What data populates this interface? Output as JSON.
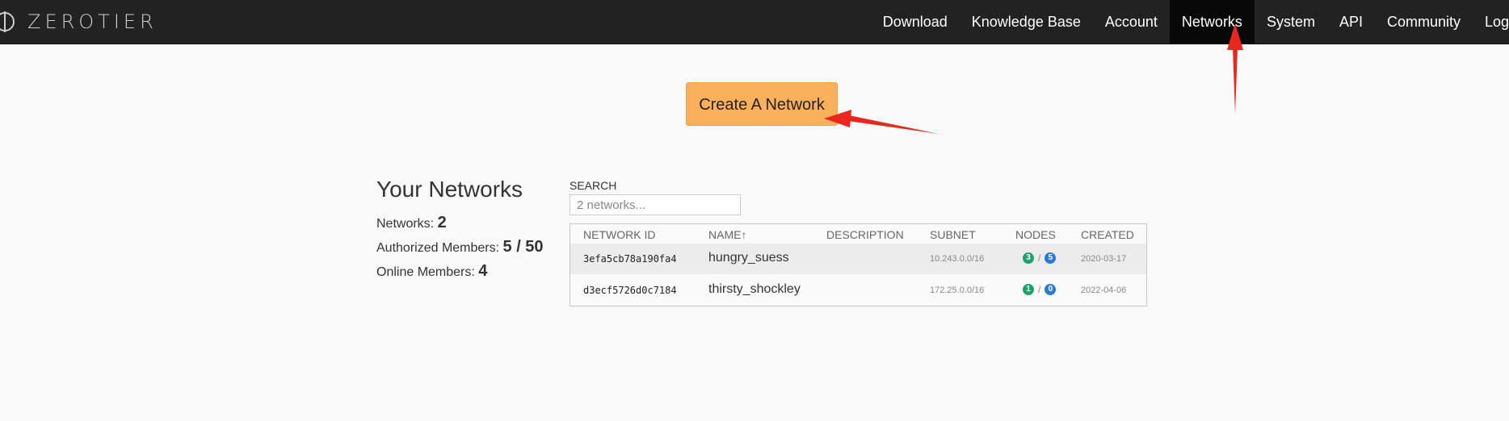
{
  "navbar": {
    "logo_text": "ZEROTIER",
    "items": [
      {
        "label": "Download"
      },
      {
        "label": "Knowledge Base"
      },
      {
        "label": "Account"
      },
      {
        "label": "Networks",
        "active": true
      },
      {
        "label": "System"
      },
      {
        "label": "API"
      },
      {
        "label": "Community"
      },
      {
        "label": "Logout"
      }
    ]
  },
  "create_button": {
    "label": "Create A Network"
  },
  "summary": {
    "title": "Your Networks",
    "networks_label": "Networks:",
    "networks_value": "2",
    "authorized_label": "Authorized Members:",
    "authorized_value": "5 / 50",
    "online_label": "Online Members:",
    "online_value": "4"
  },
  "search": {
    "label": "SEARCH",
    "placeholder": "2 networks..."
  },
  "table": {
    "headers": {
      "network_id": "NETWORK ID",
      "name": "NAME↑",
      "description": "DESCRIPTION",
      "subnet": "SUBNET",
      "nodes": "NODES",
      "created": "CREATED"
    },
    "rows": [
      {
        "network_id": "3efa5cb78a190fa4",
        "name": "hungry_suess",
        "description": "",
        "subnet": "10.243.0.0/16",
        "nodes_online": "3",
        "nodes_total": "5",
        "created": "2020-03-17"
      },
      {
        "network_id": "d3ecf5726d0c7184",
        "name": "thirsty_shockley",
        "description": "",
        "subnet": "172.25.0.0/16",
        "nodes_online": "1",
        "nodes_total": "0",
        "created": "2022-04-06"
      }
    ]
  },
  "colors": {
    "navbar_bg": "#222222",
    "active_nav_bg": "#080808",
    "button_bg": "#fbb05b",
    "badge_online": "#1aa36c",
    "badge_total": "#2b7bd1",
    "annotation_arrow": "#e8271e"
  }
}
